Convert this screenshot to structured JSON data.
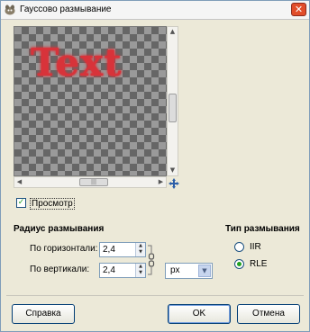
{
  "window": {
    "title": "Гауссово размывание"
  },
  "preview": {
    "sample_text": "Text",
    "checkbox_label": "Просмотр",
    "checkbox_checked": true
  },
  "blur_radius": {
    "heading": "Радиус размывания",
    "horizontal_label": "По горизонтали:",
    "horizontal_value": "2,4",
    "vertical_label": "По вертикали:",
    "vertical_value": "2,4",
    "unit": "px"
  },
  "blur_type": {
    "heading": "Тип размывания",
    "options": [
      {
        "label": "IIR",
        "selected": false
      },
      {
        "label": "RLE",
        "selected": true
      }
    ]
  },
  "buttons": {
    "help": "Справка",
    "ok": "OK",
    "cancel": "Отмена"
  },
  "colors": {
    "accent": "#21a121",
    "preview_text": "#d8333a",
    "close_button": "#e14d2a"
  }
}
